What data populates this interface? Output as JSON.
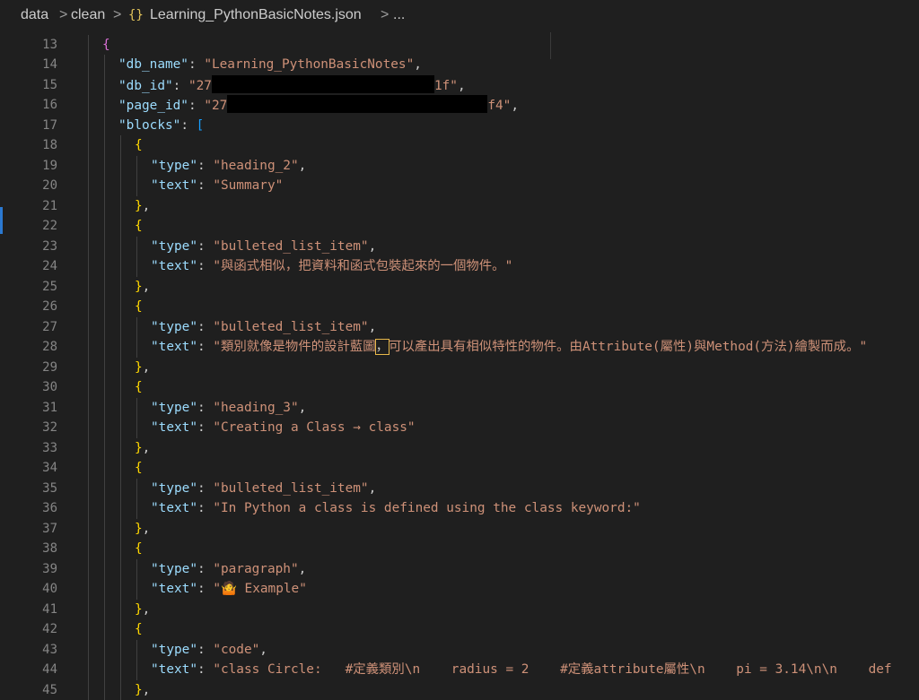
{
  "breadcrumb": {
    "items": [
      "data",
      "clean",
      "Learning_PythonBasicNotes.json",
      "..."
    ],
    "json_icon": "{}",
    "separator": ">"
  },
  "editor": {
    "colors": {
      "key": "#9cdcfe",
      "string": "#ce9178",
      "bracket_level1": "#da70d6",
      "bracket_level2": "#179fff",
      "bracket_level3": "#ffd700",
      "line_number": "#858585"
    },
    "lines": [
      {
        "n": "13",
        "indent": 1,
        "tokens": [
          [
            "b1",
            "{"
          ]
        ]
      },
      {
        "n": "14",
        "indent": 2,
        "tokens": [
          [
            "k",
            "\"db_name\""
          ],
          [
            "p",
            ": "
          ],
          [
            "s",
            "\"Learning_PythonBasicNotes\""
          ],
          [
            "p",
            ","
          ]
        ]
      },
      {
        "n": "15",
        "indent": 2,
        "tokens": [
          [
            "k",
            "\"db_id\""
          ],
          [
            "p",
            ": "
          ],
          [
            "s",
            "\"27"
          ],
          [
            "redact",
            "248"
          ],
          [
            "s",
            "1f\""
          ],
          [
            "p",
            ","
          ]
        ]
      },
      {
        "n": "16",
        "indent": 2,
        "tokens": [
          [
            "k",
            "\"page_id\""
          ],
          [
            "p",
            ": "
          ],
          [
            "s",
            "\"27"
          ],
          [
            "redact",
            "290"
          ],
          [
            "s",
            "f4\""
          ],
          [
            "p",
            ","
          ]
        ]
      },
      {
        "n": "17",
        "indent": 2,
        "tokens": [
          [
            "k",
            "\"blocks\""
          ],
          [
            "p",
            ": "
          ],
          [
            "b2",
            "["
          ]
        ]
      },
      {
        "n": "18",
        "indent": 3,
        "tokens": [
          [
            "b3",
            "{"
          ]
        ]
      },
      {
        "n": "19",
        "indent": 4,
        "tokens": [
          [
            "k",
            "\"type\""
          ],
          [
            "p",
            ": "
          ],
          [
            "s",
            "\"heading_2\""
          ],
          [
            "p",
            ","
          ]
        ]
      },
      {
        "n": "20",
        "indent": 4,
        "tokens": [
          [
            "k",
            "\"text\""
          ],
          [
            "p",
            ": "
          ],
          [
            "s",
            "\"Summary\""
          ]
        ]
      },
      {
        "n": "21",
        "indent": 3,
        "tokens": [
          [
            "b3",
            "}"
          ],
          [
            "p",
            ","
          ]
        ]
      },
      {
        "n": "22",
        "indent": 3,
        "tokens": [
          [
            "b3",
            "{"
          ]
        ]
      },
      {
        "n": "23",
        "indent": 4,
        "tokens": [
          [
            "k",
            "\"type\""
          ],
          [
            "p",
            ": "
          ],
          [
            "s",
            "\"bulleted_list_item\""
          ],
          [
            "p",
            ","
          ]
        ]
      },
      {
        "n": "24",
        "indent": 4,
        "tokens": [
          [
            "k",
            "\"text\""
          ],
          [
            "p",
            ": "
          ],
          [
            "s",
            "\"與函式相似，把資料和函式包裝起來的一個物件。\""
          ]
        ]
      },
      {
        "n": "25",
        "indent": 3,
        "tokens": [
          [
            "b3",
            "}"
          ],
          [
            "p",
            ","
          ]
        ]
      },
      {
        "n": "26",
        "indent": 3,
        "tokens": [
          [
            "b3",
            "{"
          ]
        ]
      },
      {
        "n": "27",
        "indent": 4,
        "tokens": [
          [
            "k",
            "\"type\""
          ],
          [
            "p",
            ": "
          ],
          [
            "s",
            "\"bulleted_list_item\""
          ],
          [
            "p",
            ","
          ]
        ]
      },
      {
        "n": "28",
        "indent": 4,
        "tokens": [
          [
            "k",
            "\"text\""
          ],
          [
            "p",
            ": "
          ],
          [
            "s",
            "\"類別就像是物件的設計藍圖"
          ],
          [
            "hl",
            "，"
          ],
          [
            "s",
            "可以產出具有相似特性的物件。由Attribute(屬性)與Method(方法)繪製而成。\""
          ]
        ]
      },
      {
        "n": "29",
        "indent": 3,
        "tokens": [
          [
            "b3",
            "}"
          ],
          [
            "p",
            ","
          ]
        ]
      },
      {
        "n": "30",
        "indent": 3,
        "tokens": [
          [
            "b3",
            "{"
          ]
        ]
      },
      {
        "n": "31",
        "indent": 4,
        "tokens": [
          [
            "k",
            "\"type\""
          ],
          [
            "p",
            ": "
          ],
          [
            "s",
            "\"heading_3\""
          ],
          [
            "p",
            ","
          ]
        ]
      },
      {
        "n": "32",
        "indent": 4,
        "tokens": [
          [
            "k",
            "\"text\""
          ],
          [
            "p",
            ": "
          ],
          [
            "s",
            "\"Creating a Class → class\""
          ]
        ]
      },
      {
        "n": "33",
        "indent": 3,
        "tokens": [
          [
            "b3",
            "}"
          ],
          [
            "p",
            ","
          ]
        ]
      },
      {
        "n": "34",
        "indent": 3,
        "tokens": [
          [
            "b3",
            "{"
          ]
        ]
      },
      {
        "n": "35",
        "indent": 4,
        "tokens": [
          [
            "k",
            "\"type\""
          ],
          [
            "p",
            ": "
          ],
          [
            "s",
            "\"bulleted_list_item\""
          ],
          [
            "p",
            ","
          ]
        ]
      },
      {
        "n": "36",
        "indent": 4,
        "tokens": [
          [
            "k",
            "\"text\""
          ],
          [
            "p",
            ": "
          ],
          [
            "s",
            "\"In Python a class is defined using the class keyword:\""
          ]
        ]
      },
      {
        "n": "37",
        "indent": 3,
        "tokens": [
          [
            "b3",
            "}"
          ],
          [
            "p",
            ","
          ]
        ]
      },
      {
        "n": "38",
        "indent": 3,
        "tokens": [
          [
            "b3",
            "{"
          ]
        ]
      },
      {
        "n": "39",
        "indent": 4,
        "tokens": [
          [
            "k",
            "\"type\""
          ],
          [
            "p",
            ": "
          ],
          [
            "s",
            "\"paragraph\""
          ],
          [
            "p",
            ","
          ]
        ]
      },
      {
        "n": "40",
        "indent": 4,
        "tokens": [
          [
            "k",
            "\"text\""
          ],
          [
            "p",
            ": "
          ],
          [
            "s",
            "\"🤷 Example\""
          ]
        ]
      },
      {
        "n": "41",
        "indent": 3,
        "tokens": [
          [
            "b3",
            "}"
          ],
          [
            "p",
            ","
          ]
        ]
      },
      {
        "n": "42",
        "indent": 3,
        "tokens": [
          [
            "b3",
            "{"
          ]
        ]
      },
      {
        "n": "43",
        "indent": 4,
        "tokens": [
          [
            "k",
            "\"type\""
          ],
          [
            "p",
            ": "
          ],
          [
            "s",
            "\"code\""
          ],
          [
            "p",
            ","
          ]
        ]
      },
      {
        "n": "44",
        "indent": 4,
        "tokens": [
          [
            "k",
            "\"text\""
          ],
          [
            "p",
            ": "
          ],
          [
            "s",
            "\"class Circle:   #定義類別\\n    radius = 2    #定義attribute屬性\\n    pi = 3.14\\n\\n    def"
          ]
        ]
      },
      {
        "n": "45",
        "indent": 3,
        "tokens": [
          [
            "b3",
            "}"
          ],
          [
            "p",
            ","
          ]
        ]
      }
    ]
  }
}
